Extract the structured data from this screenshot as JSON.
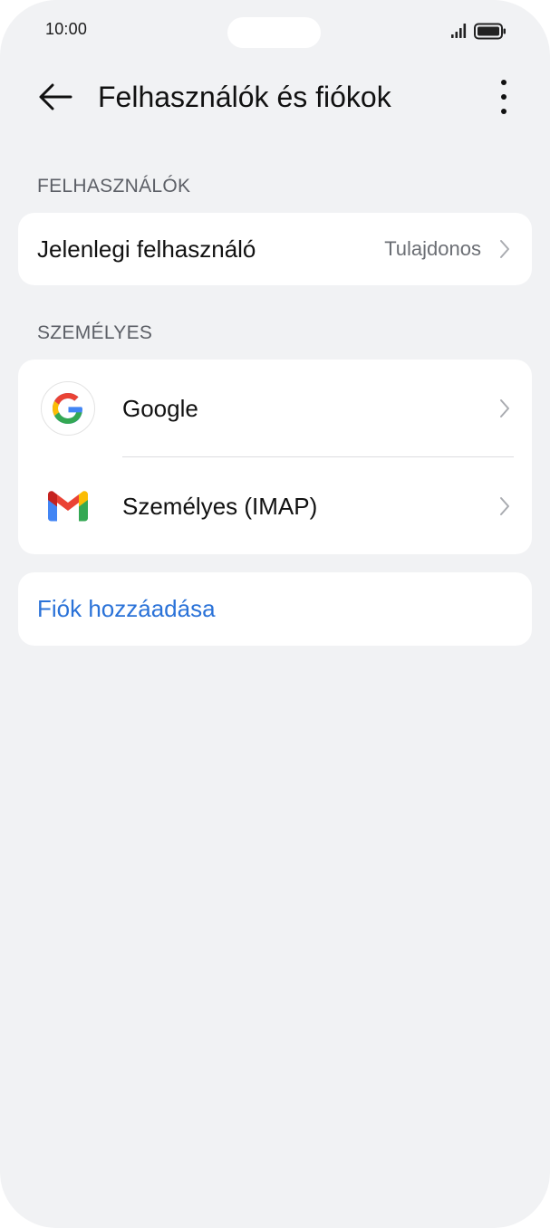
{
  "status_bar": {
    "time": "10:00"
  },
  "header": {
    "title": "Felhasználók és fiókok"
  },
  "users_section": {
    "header": "FELHASZNÁLÓK",
    "current_user_label": "Jelenlegi felhasználó",
    "current_user_value": "Tulajdonos"
  },
  "personal_section": {
    "header": "SZEMÉLYES",
    "accounts": [
      {
        "label": "Google",
        "icon": "google-icon"
      },
      {
        "label": "Személyes (IMAP)",
        "icon": "gmail-icon"
      }
    ]
  },
  "add_account": {
    "label": "Fiók hozzáadása"
  },
  "colors": {
    "background": "#f1f2f4",
    "card": "#ffffff",
    "accent_link": "#2a72d8",
    "text_primary": "#111111",
    "text_secondary": "#6b6e74"
  }
}
